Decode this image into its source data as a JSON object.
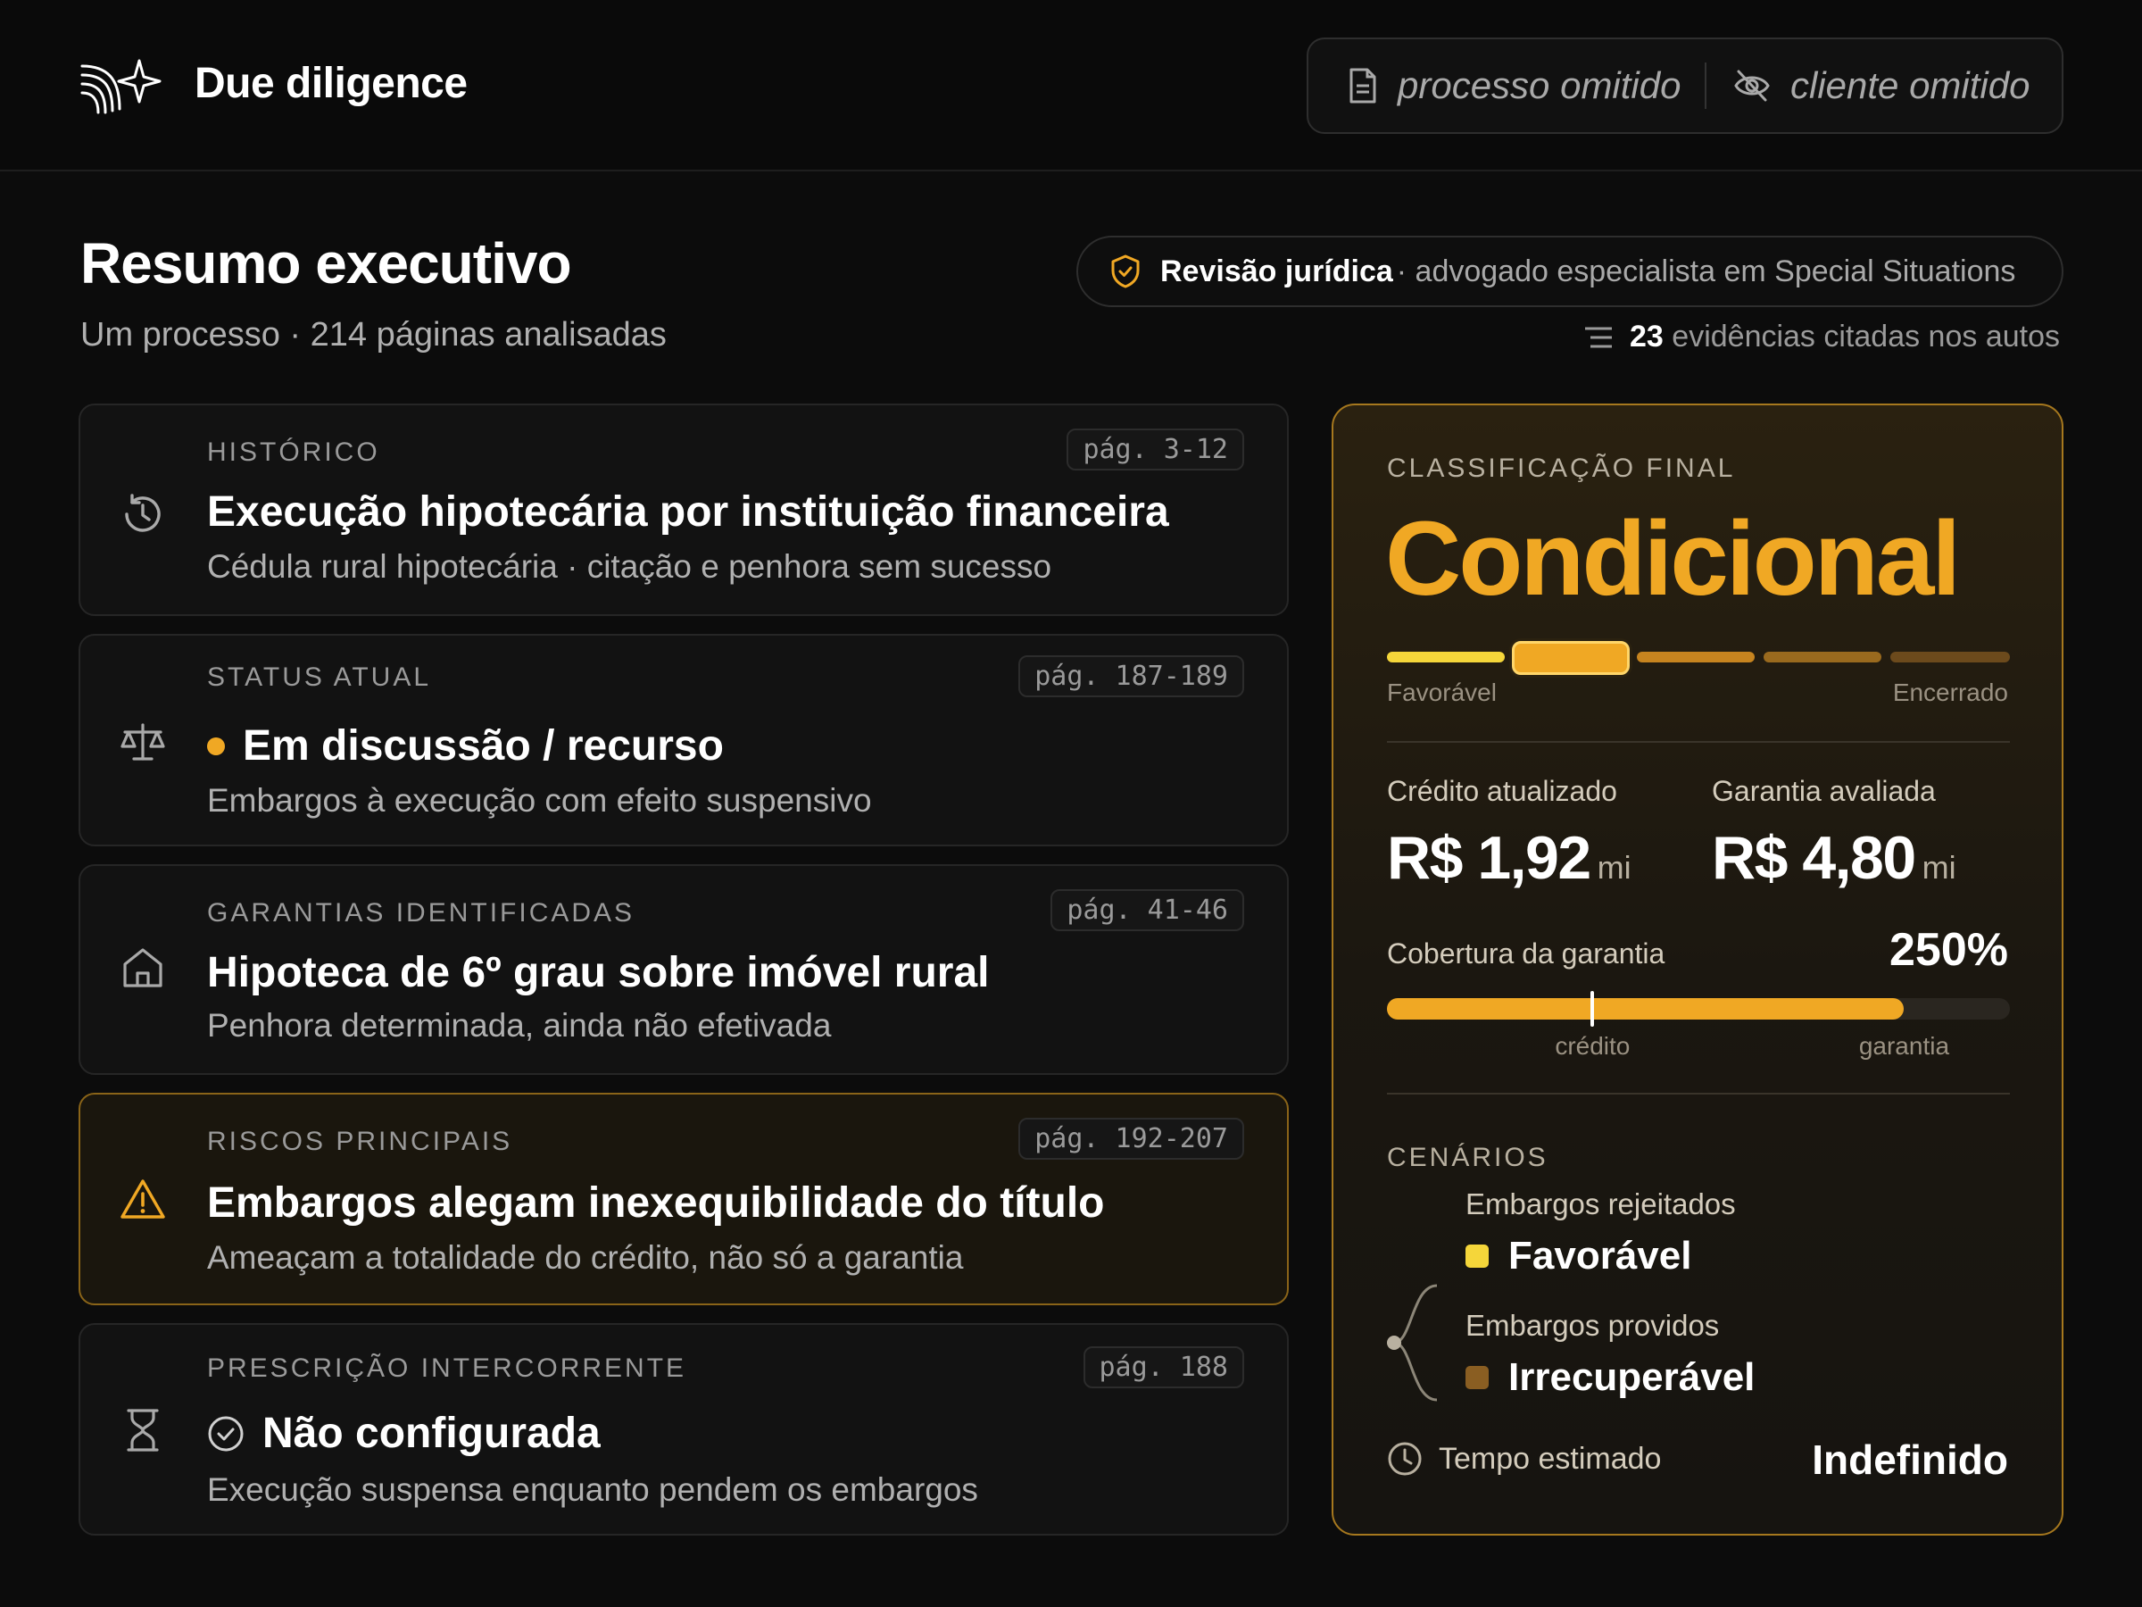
{
  "header": {
    "app_title": "Due diligence",
    "process_label": "processo omitido",
    "client_label": "cliente omitido"
  },
  "summary": {
    "title": "Resumo executivo",
    "subtitle": "Um processo · 214 páginas analisadas",
    "review_strong": "Revisão jurídica",
    "review_rest": "· advogado especialista em Special Situations",
    "evidence_count": "23",
    "evidence_text": "evidências citadas nos autos"
  },
  "cards": [
    {
      "label": "HISTÓRICO",
      "page": "pág. 3-12",
      "title": "Execução hipotecária por instituição financeira",
      "desc": "Cédula rural hipotecária · citação e penhora sem sucesso",
      "icon": "history-icon"
    },
    {
      "label": "STATUS ATUAL",
      "page": "pág. 187-189",
      "title": "Em discussão / recurso",
      "desc": "Embargos à execução com efeito suspensivo",
      "icon": "scale-icon"
    },
    {
      "label": "GARANTIAS IDENTIFICADAS",
      "page": "pág. 41-46",
      "title": "Hipoteca de 6º grau sobre imóvel rural",
      "desc": "Penhora determinada, ainda não efetivada",
      "icon": "house-icon"
    },
    {
      "label": "RISCOS PRINCIPAIS",
      "page": "pág. 192-207",
      "title": "Embargos alegam inexequibilidade do título",
      "desc": "Ameaçam a totalidade do crédito, não só a garantia",
      "icon": "warning-icon"
    },
    {
      "label": "PRESCRIÇÃO INTERCORRENTE",
      "page": "pág. 188",
      "title": "Não configurada",
      "desc": "Execução suspensa enquanto pendem os embargos",
      "icon": "hourglass-icon"
    }
  ],
  "classification": {
    "label": "CLASSIFICAÇÃO FINAL",
    "value": "Condicional",
    "scale_left": "Favorável",
    "scale_right": "Encerrado",
    "scale_selected_index": 1,
    "scale_steps": 5
  },
  "metrics": {
    "credit_label": "Crédito atualizado",
    "credit_value": "R$ 1,92",
    "credit_unit": "mi",
    "guarantee_label": "Garantia avaliada",
    "guarantee_value": "R$ 4,80",
    "guarantee_unit": "mi"
  },
  "coverage": {
    "label": "Cobertura da garantia",
    "value": "250%",
    "credit_tick": "crédito",
    "guarantee_tick": "garantia",
    "credit_fraction": 0.33,
    "guarantee_fraction": 0.83
  },
  "scenarios": {
    "label": "CENÁRIOS",
    "items": [
      {
        "condition": "Embargos rejeitados",
        "result": "Favorável",
        "color": "#f5d63a"
      },
      {
        "condition": "Embargos providos",
        "result": "Irrecuperável",
        "color": "#8a5e22"
      }
    ]
  },
  "tempo": {
    "label": "Tempo estimado",
    "value": "Indefinido"
  },
  "colors": {
    "accent": "#f0a824",
    "background": "#0c0c0c",
    "risk_border": "#8a6418"
  }
}
